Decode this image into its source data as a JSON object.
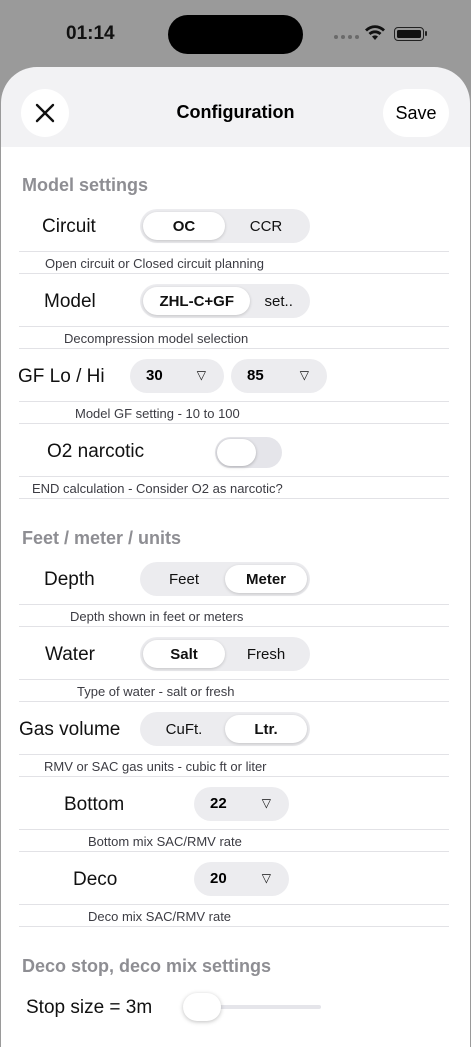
{
  "status_bar": {
    "time": "01:14"
  },
  "nav": {
    "title": "Configuration",
    "save_label": "Save"
  },
  "sections": {
    "model": "Model settings",
    "units": "Feet / meter / units",
    "deco": "Deco stop, deco mix settings"
  },
  "circuit": {
    "label": "Circuit",
    "options": [
      "OC",
      "CCR"
    ],
    "selected": "OC",
    "desc": "Open circuit or Closed circuit planning"
  },
  "model": {
    "label": "Model",
    "options": [
      "ZHL-C+GF",
      "set.."
    ],
    "selected": "ZHL-C+GF",
    "desc": "Decompression model selection"
  },
  "gf": {
    "label": "GF Lo / Hi",
    "lo": "30",
    "hi": "85",
    "desc": "Model GF setting - 10 to 100"
  },
  "o2": {
    "label": "O2 narcotic",
    "on": false,
    "desc": "END calculation - Consider O2 as narcotic?"
  },
  "depth": {
    "label": "Depth",
    "options": [
      "Feet",
      "Meter"
    ],
    "selected": "Meter",
    "desc": "Depth shown in feet or meters"
  },
  "water": {
    "label": "Water",
    "options": [
      "Salt",
      "Fresh"
    ],
    "selected": "Salt",
    "desc": "Type of water - salt or fresh"
  },
  "gas_volume": {
    "label": "Gas volume",
    "options": [
      "CuFt.",
      "Ltr."
    ],
    "selected": "Ltr.",
    "desc": "RMV or SAC gas units - cubic ft or liter"
  },
  "bottom": {
    "label": "Bottom",
    "value": "22",
    "desc": "Bottom mix SAC/RMV rate"
  },
  "deco": {
    "label": "Deco",
    "value": "20",
    "desc": "Deco mix SAC/RMV rate"
  },
  "stop_size": {
    "label": "Stop size = 3m",
    "slider_fraction": 0.0
  }
}
